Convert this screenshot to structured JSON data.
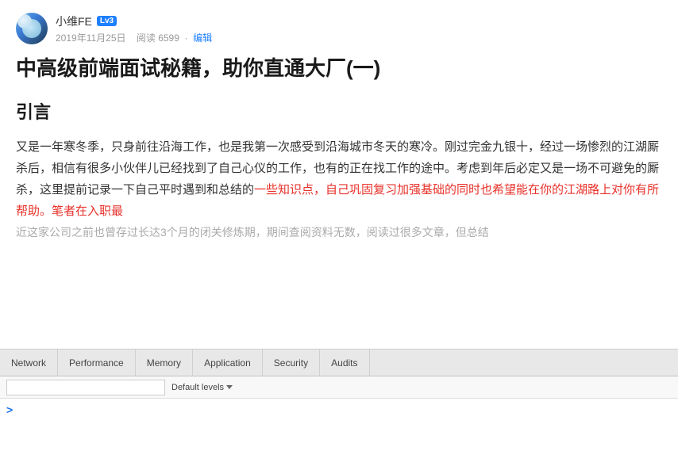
{
  "article": {
    "author": {
      "name": "小维FE",
      "level": "Lv3",
      "date": "2019年11月25日",
      "reads": "阅读 6599",
      "edit_label": "编辑"
    },
    "title": "中高级前端面试秘籍，助你直通大厂(一)",
    "section": "引言",
    "body_part1": "又是一年寒冬季，只身前往沿海工作，也是我第一次感受到沿海城市冬天的寒冷。刚过完金九银十，经过一场惨烈的江湖厮杀后，相信有很多小伙伴儿已经找到了自己心仪的工作，也有的正在找工作的途中。考虑到年后必定又是一场不可避免的厮杀，这里提前记录一下自己平时遇到和总结的一些知识点，自己巩固复习加强基础的同时也希望能在你的江湖路上对你有所帮助。笔者在入职最",
    "body_part2": "近这家公司之前也曾存过长达3个月的闭关修炼期，期间查阅资料无数，阅读过很多文章，但总结"
  },
  "devtools": {
    "tabs": [
      {
        "id": "network",
        "label": "Network",
        "active": false
      },
      {
        "id": "performance",
        "label": "Performance",
        "active": false
      },
      {
        "id": "memory",
        "label": "Memory",
        "active": false
      },
      {
        "id": "application",
        "label": "Application",
        "active": false
      },
      {
        "id": "security",
        "label": "Security",
        "active": false
      },
      {
        "id": "audits",
        "label": "Audits",
        "active": false
      }
    ],
    "console": {
      "filter_placeholder": "",
      "default_levels_label": "Default levels",
      "prompt_symbol": ">"
    }
  }
}
